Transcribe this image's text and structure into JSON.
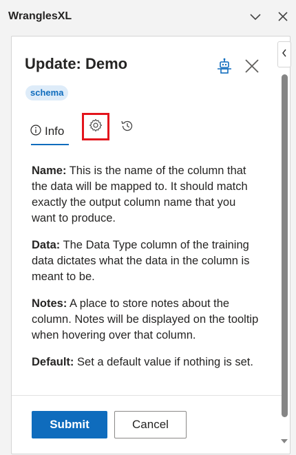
{
  "pane": {
    "title": "WranglesXL",
    "icons": {
      "collapse": "chevron-down-icon",
      "close": "close-icon"
    }
  },
  "card": {
    "title": "Update: Demo",
    "badge": "schema",
    "header_icons": {
      "robot": "robot-icon",
      "close": "close-icon"
    }
  },
  "tabs": [
    {
      "label": "Info",
      "icon": "info-icon",
      "selected": true
    },
    {
      "label": "",
      "icon": "gear-icon",
      "selected": false
    },
    {
      "label": "",
      "icon": "history-icon",
      "selected": false
    }
  ],
  "content": {
    "items": [
      {
        "term": "Name:",
        "text": " This is the name of the column that the data will be mapped to. It should match exactly the output column name that you want to produce."
      },
      {
        "term": "Data:",
        "text": " The Data Type column of the training data dictates what the data in the column is meant to be."
      },
      {
        "term": "Notes:",
        "text": " A place to store notes about the column. Notes will be displayed on the tooltip when hovering over that column."
      },
      {
        "term": "Default:",
        "text": " Set a default value if nothing is set."
      }
    ]
  },
  "footer": {
    "submit_label": "Submit",
    "cancel_label": "Cancel"
  },
  "colors": {
    "accent": "#0f6cbd",
    "highlight_box": "#e3141c",
    "badge_bg": "#deecf9"
  }
}
